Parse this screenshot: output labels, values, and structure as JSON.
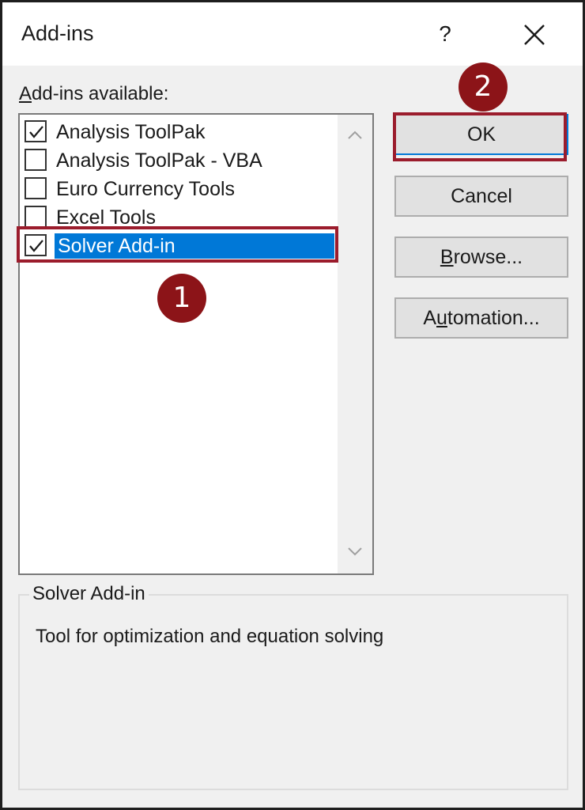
{
  "dialog": {
    "title": "Add-ins",
    "help_label": "?"
  },
  "list": {
    "label_accel": "A",
    "label_rest": "dd-ins available:",
    "items": [
      {
        "label": "Analysis ToolPak",
        "checked": true
      },
      {
        "label": "Analysis ToolPak - VBA",
        "checked": false
      },
      {
        "label": "Euro Currency Tools",
        "checked": false
      },
      {
        "label": "Excel Tools",
        "checked": false
      },
      {
        "label": "Solver Add-in",
        "checked": true,
        "selected": true
      }
    ]
  },
  "buttons": {
    "ok": "OK",
    "cancel": "Cancel",
    "browse_accel": "B",
    "browse_rest": "rowse...",
    "automation_pre": "A",
    "automation_accel": "u",
    "automation_rest": "tomation..."
  },
  "description": {
    "title": "Solver Add-in",
    "text": "Tool for optimization and equation solving"
  },
  "annotations": {
    "step1": "1",
    "step2": "2",
    "highlight_color": "#9b1c2c",
    "badge_color": "#8c1418"
  },
  "colors": {
    "selection": "#0078d7",
    "dialog_bg": "#f0f0f0"
  }
}
